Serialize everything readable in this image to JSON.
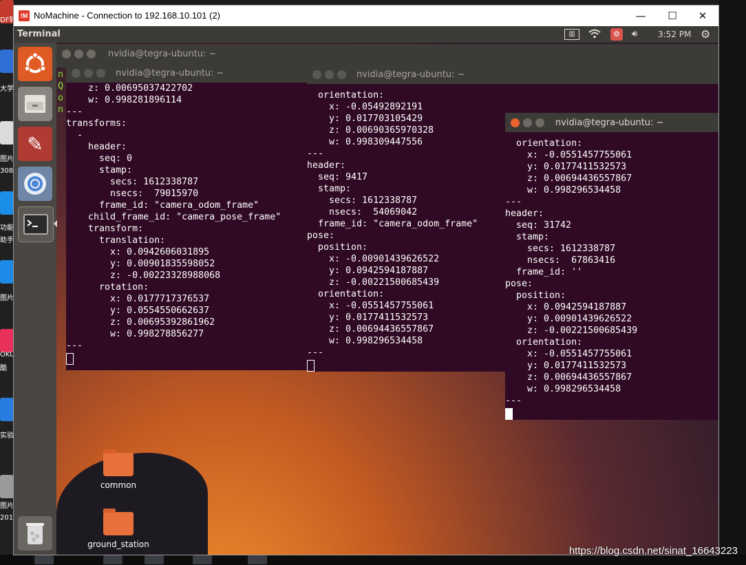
{
  "host": {
    "window_title": "NoMachine - Connection to 192.168.10.101 (2)",
    "logo_text": "!M",
    "minimize_icon": "minimize-icon",
    "maximize_icon": "maximize-icon",
    "close_icon": "close-icon",
    "watermark": "https://blog.csdn.net/sinat_16643223",
    "strip_labels": [
      "DF转",
      "大学",
      "图片",
      "308",
      "功能",
      "助手",
      "图片",
      "OKU",
      "酷",
      "实验",
      "图片",
      "201"
    ]
  },
  "ubuntu": {
    "topbar_title": "Terminal",
    "clock": "3:52 PM",
    "indicators": [
      "keyboard-icon",
      "wifi-icon",
      "update-icon",
      "volume-icon",
      "gear-icon"
    ],
    "launcher": [
      "ubuntu-logo-icon",
      "files-icon",
      "settings-icon",
      "chromium-icon",
      "terminal-icon",
      "trash-icon"
    ],
    "desktop_icons": [
      {
        "label": "common"
      },
      {
        "label": "ground_station"
      }
    ]
  },
  "terminals": {
    "back": {
      "title": "nvidia@tegra-ubuntu: ~"
    },
    "w1": {
      "title": "nvidia@tegra-ubuntu: ~",
      "side_chars": "n\nQ\no\nn",
      "lines": "    z: 0.00695037422702\n    w: 0.998281896114\n---\ntransforms:\n  -\n    header:\n      seq: 0\n      stamp:\n        secs: 1612338787\n        nsecs:  79015970\n      frame_id: \"camera_odom_frame\"\n    child_frame_id: \"camera_pose_frame\"\n    transform:\n      translation:\n        x: 0.0942606031895\n        y: 0.00901835598052\n        z: -0.00223328988068\n      rotation:\n        x: 0.0177717376537\n        y: 0.0554550662637\n        z: 0.00695392861962\n        w: 0.998278856277\n---"
    },
    "w2": {
      "title": "nvidia@tegra-ubuntu: ~",
      "lines": "  orientation:\n    x: -0.05492892191\n    y: 0.017703105429\n    z: 0.00690365970328\n    w: 0.998309447556\n---\nheader:\n  seq: 9417\n  stamp:\n    secs: 1612338787\n    nsecs:  54069042\n  frame_id: \"camera_odom_frame\"\npose:\n  position:\n    x: -0.00901439626522\n    y: 0.0942594187887\n    z: -0.00221500685439\n  orientation:\n    x: -0.0551457755061\n    y: 0.0177411532573\n    z: 0.00694436557867\n    w: 0.998296534458\n---"
    },
    "w3": {
      "title": "nvidia@tegra-ubuntu: ~",
      "lines": "  orientation:\n    x: -0.0551457755061\n    y: 0.0177411532573\n    z: 0.00694436557867\n    w: 0.998296534458\n---\nheader:\n  seq: 31742\n  stamp:\n    secs: 1612338787\n    nsecs:  67863416\n  frame_id: ''\npose:\n  position:\n    x: 0.0942594187887\n    y: 0.00901439626522\n    z: -0.00221500685439\n  orientation:\n    x: -0.0551457755061\n    y: 0.0177411532573\n    z: 0.00694436557867\n    w: 0.998296534458\n---"
    }
  }
}
